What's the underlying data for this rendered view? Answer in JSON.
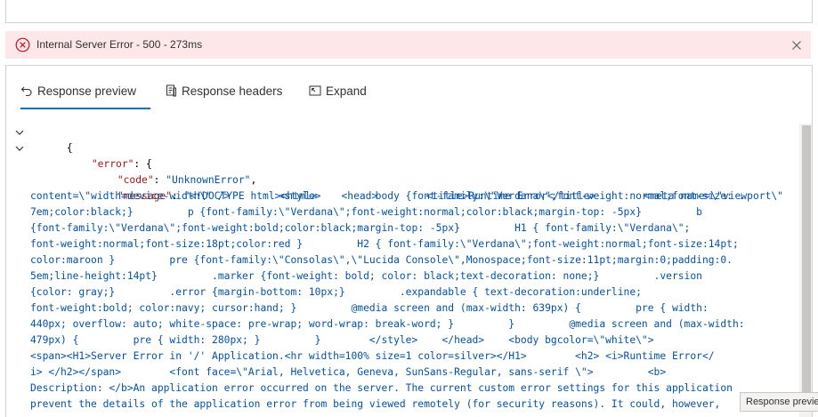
{
  "error_banner": {
    "text": "Internal Server Error - 500 - 273ms",
    "color": "#fde7e9",
    "icon": "error-circle-icon"
  },
  "tabs": [
    {
      "label": "Response preview",
      "icon": "undo-arrow-icon",
      "active": true
    },
    {
      "label": "Response headers",
      "icon": "document-icon",
      "active": false
    },
    {
      "label": "Expand",
      "icon": "expand-icon",
      "active": false
    }
  ],
  "accent_color": "#0f6cbd",
  "code": {
    "open_brace": "{",
    "error_key": "\"error\"",
    "error_open": ": {",
    "code_key": "\"code\"",
    "code_value": "\"UnknownError\"",
    "message_key": "\"message\"",
    "message_lines": [
      "\"<!DOCTYPE html><html>    <head>        <title>Runtime Error</title>        <meta name=\\\"viewport\\\"",
      "content=\\\"width=device-width\\\" />        <style>         body {font-family:\\\"Verdana\\\";font-weight:normal;font-size: .",
      "7em;color:black;}         p {font-family:\\\"Verdana\\\";font-weight:normal;color:black;margin-top: -5px}         b",
      "{font-family:\\\"Verdana\\\";font-weight:bold;color:black;margin-top: -5px}         H1 { font-family:\\\"Verdana\\\";",
      "font-weight:normal;font-size:18pt;color:red }         H2 { font-family:\\\"Verdana\\\";font-weight:normal;font-size:14pt;",
      "color:maroon }         pre {font-family:\\\"Consolas\\\",\\\"Lucida Console\\\",Monospace;font-size:11pt;margin:0;padding:0.",
      "5em;line-height:14pt}         .marker {font-weight: bold; color: black;text-decoration: none;}         .version",
      "{color: gray;}         .error {margin-bottom: 10px;}         .expandable { text-decoration:underline;",
      "font-weight:bold; color:navy; cursor:hand; }         @media screen and (max-width: 639px) {         pre { width:",
      "440px; overflow: auto; white-space: pre-wrap; word-wrap: break-word; }         }         @media screen and (max-width:",
      "479px) {         pre { width: 280px; }         }        </style>    </head>    <body bgcolor=\\\"white\\\">",
      "<span><H1>Server Error in '/' Application.<hr width=100% size=1 color=silver></H1>        <h2> <i>Runtime Error</",
      "i> </h2></span>        <font face=\\\"Arial, Helvetica, Geneva, SunSans-Regular, sans-serif \\\">         <b>",
      "Description: </b>An application error occurred on the server. The current custom error settings for this application",
      "prevent the details of the application error from being viewed remotely (for security reasons). It could, however,"
    ]
  },
  "tooltip": "Response preview"
}
